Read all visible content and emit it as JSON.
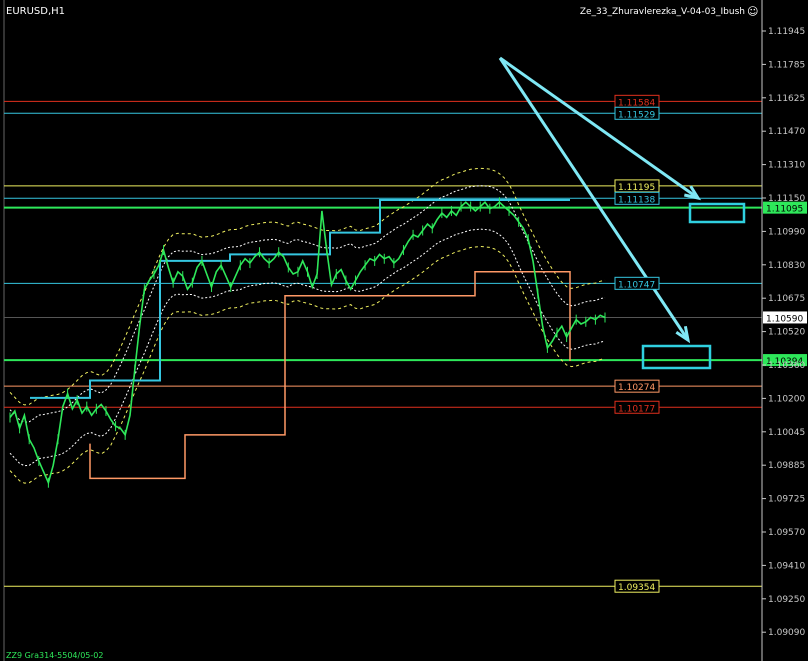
{
  "header": {
    "symbol": "EURUSD,H1",
    "indicator": "Ze_33_Zhuravlerezka_V-04-03_Ibush",
    "smiley": "☺",
    "footer": "ZZ9 Gra314-5504/05-02"
  },
  "colors": {
    "bg": "#000000",
    "axis": "#c8c8c8",
    "red": "#e0301e",
    "cyan": "#35c6e0",
    "yellow": "#f0f060",
    "orange": "#ff9966",
    "green": "#2ee85a",
    "white": "#ffffff",
    "gray": "#c0c0c0",
    "arrow": "#7fe8f5",
    "bbox": "#30d0e0"
  },
  "chart_data": {
    "type": "line",
    "ylim": [
      1.0901,
      1.1205
    ],
    "y_ticks": [
      "1.11945",
      "1.11785",
      "1.11625",
      "1.11470",
      "1.11310",
      "1.11150",
      "1.10990",
      "1.10830",
      "1.10675",
      "1.10520",
      "1.10360",
      "1.10200",
      "1.10045",
      "1.09885",
      "1.09725",
      "1.09570",
      "1.09410",
      "1.09250",
      "1.09090"
    ],
    "levels": [
      {
        "label": "1.11584",
        "value": 1.11584,
        "color": "red",
        "tag": true
      },
      {
        "label": "1.11529",
        "value": 1.11529,
        "color": "cyan",
        "tag": true
      },
      {
        "label": "1.11195",
        "value": 1.11195,
        "color": "yellow",
        "tag": true
      },
      {
        "label": "1.11138",
        "value": 1.11138,
        "color": "cyan",
        "tag": true
      },
      {
        "label": "1.10747",
        "value": 1.10747,
        "color": "cyan",
        "tag": true
      },
      {
        "label": "1.10274",
        "value": 1.10274,
        "color": "orange",
        "tag": true
      },
      {
        "label": "1.10177",
        "value": 1.10177,
        "color": "red",
        "tag": true
      },
      {
        "label": "1.09354",
        "value": 1.09354,
        "color": "yellow",
        "tag": true
      }
    ],
    "markers": [
      {
        "label": "1.11095",
        "value": 1.11095,
        "color": "green"
      },
      {
        "label": "1.10590",
        "value": 1.1059,
        "color": "gray"
      },
      {
        "label": "1.10394",
        "value": 1.10394,
        "color": "green"
      }
    ],
    "price": [
      1.1013,
      1.1016,
      1.1008,
      1.1014,
      1.1003,
      1.0999,
      1.0993,
      1.0988,
      1.0983,
      1.0991,
      1.1003,
      1.1018,
      1.1024,
      1.1017,
      1.1021,
      1.1015,
      1.1018,
      1.1014,
      1.1017,
      1.1019,
      1.1016,
      1.1012,
      1.1009,
      1.1008,
      1.1005,
      1.1014,
      1.1035,
      1.1055,
      1.1072,
      1.1076,
      1.1079,
      1.1083,
      1.109,
      1.1082,
      1.1075,
      1.108,
      1.1078,
      1.1072,
      1.1075,
      1.1082,
      1.1085,
      1.1079,
      1.1073,
      1.108,
      1.1083,
      1.1078,
      1.1073,
      1.1078,
      1.1083,
      1.1086,
      1.1084,
      1.1087,
      1.1089,
      1.1086,
      1.1084,
      1.1086,
      1.1089,
      1.1087,
      1.1082,
      1.1079,
      1.108,
      1.1085,
      1.108,
      1.1073,
      1.1079,
      1.1108,
      1.109,
      1.1074,
      1.1079,
      1.1081,
      1.1076,
      1.1072,
      1.1076,
      1.108,
      1.1083,
      1.1086,
      1.1085,
      1.1088,
      1.1086,
      1.1087,
      1.1084,
      1.1086,
      1.109,
      1.1094,
      1.1097,
      1.1096,
      1.1099,
      1.1102,
      1.11,
      1.1104,
      1.1107,
      1.1105,
      1.1108,
      1.1106,
      1.111,
      1.1112,
      1.111,
      1.1108,
      1.111,
      1.1112,
      1.1109,
      1.111,
      1.1112,
      1.111,
      1.1108,
      1.1106,
      1.1103,
      1.11,
      1.1095,
      1.1085,
      1.107,
      1.1055,
      1.1045,
      1.1048,
      1.1052,
      1.1055,
      1.105,
      1.1054,
      1.1058,
      1.1056,
      1.1057,
      1.1059,
      1.1058,
      1.106,
      1.1059
    ]
  }
}
